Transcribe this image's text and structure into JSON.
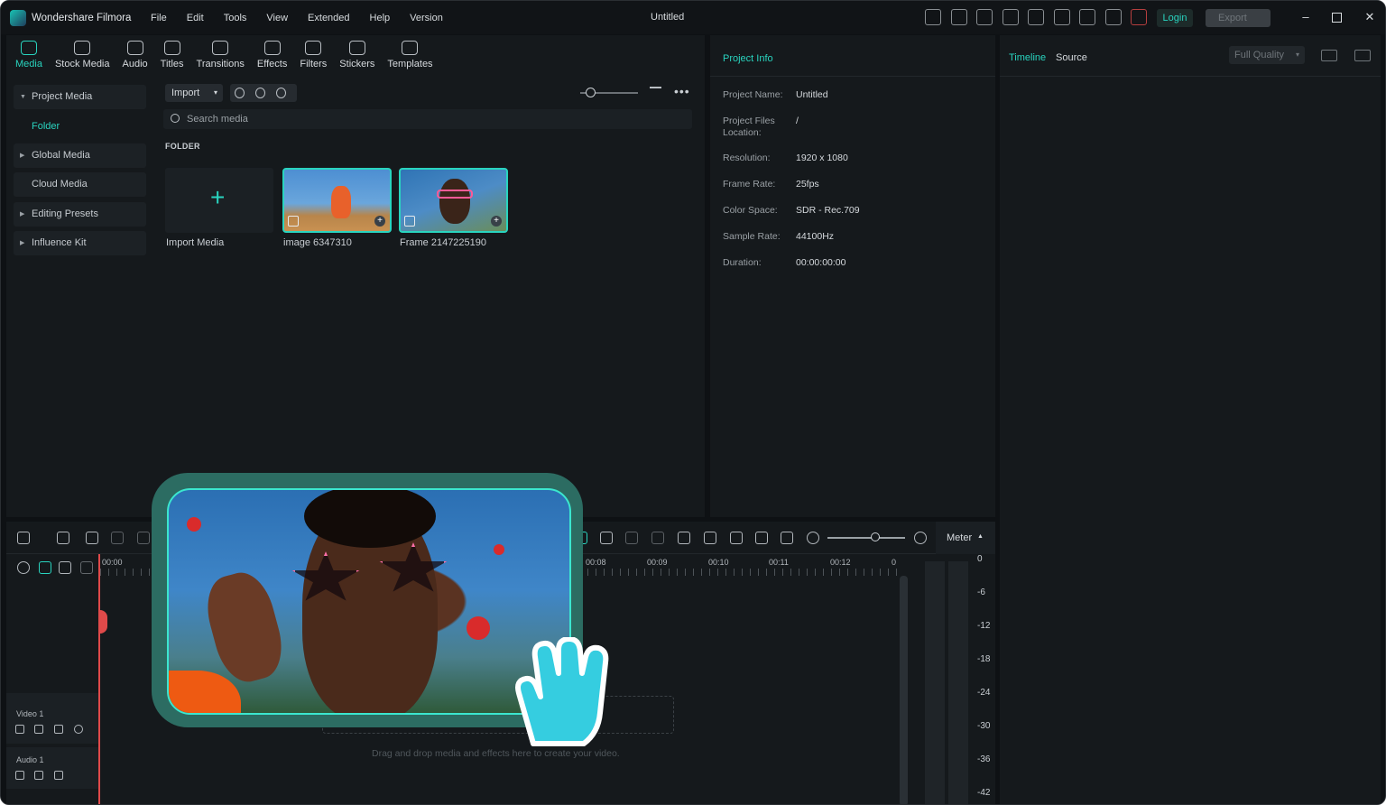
{
  "app": {
    "name": "Wondershare Filmora",
    "menu": [
      "File",
      "Edit",
      "Tools",
      "View",
      "Extended",
      "Help",
      "Version"
    ],
    "doc_title": "Untitled",
    "login_label": "Login",
    "export_label": "Export"
  },
  "toolbar_tabs": [
    "Media",
    "Stock Media",
    "Audio",
    "Titles",
    "Transitions",
    "Effects",
    "Filters",
    "Stickers",
    "Templates"
  ],
  "sidebar": {
    "items": [
      "Project Media",
      "Folder",
      "Global Media",
      "Cloud Media",
      "Editing Presets",
      "Influence Kit"
    ]
  },
  "media": {
    "import_label": "Import",
    "search_placeholder": "Search media",
    "folder_label": "FOLDER",
    "tiles": [
      "Import Media",
      "image 6347310",
      "Frame 2147225190"
    ]
  },
  "project_info": {
    "title": "Project Info",
    "rows": [
      {
        "key": "Project Name:",
        "value": "Untitled"
      },
      {
        "key": "Project Files Location:",
        "value": "/"
      },
      {
        "key": "Resolution:",
        "value": "1920 x 1080"
      },
      {
        "key": "Frame Rate:",
        "value": "25fps"
      },
      {
        "key": "Color Space:",
        "value": "SDR - Rec.709"
      },
      {
        "key": "Sample Rate:",
        "value": "44100Hz"
      },
      {
        "key": "Duration:",
        "value": "00:00:00:00"
      }
    ]
  },
  "preview": {
    "tabs": [
      "Timeline",
      "Source"
    ],
    "quality": "Full Quality"
  },
  "timeline": {
    "ruler": [
      "00:00",
      "0",
      "00:08",
      "00:09",
      "00:10",
      "00:11",
      "00:12",
      "0"
    ],
    "tracks": [
      "Video 1",
      "Audio 1"
    ],
    "drop_hint": "Drag and drop media and effects here to create your video.",
    "meter_label": "Meter",
    "meter_scale": [
      "0",
      "-6",
      "-12",
      "-18",
      "-24",
      "-30",
      "-36",
      "-42"
    ]
  }
}
